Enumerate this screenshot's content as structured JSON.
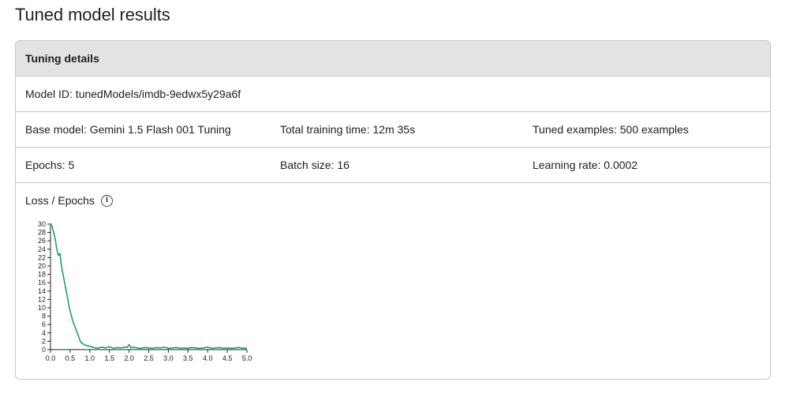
{
  "page": {
    "title": "Tuned model results"
  },
  "details": {
    "header": "Tuning details",
    "model_id": "Model ID: tunedModels/imdb-9edwx5y29a6f",
    "base_model": "Base model: Gemini 1.5 Flash 001 Tuning",
    "training_time": "Total training time: 12m 35s",
    "tuned_examples": "Tuned examples: 500 examples",
    "epochs": "Epochs: 5",
    "batch_size": "Batch size: 16",
    "learning_rate": "Learning rate: 0.0002"
  },
  "chart": {
    "title": "Loss / Epochs",
    "icon": "info-icon"
  },
  "chart_data": {
    "type": "line",
    "title": "Loss / Epochs",
    "xlabel": "",
    "ylabel": "",
    "xlim": [
      0,
      5
    ],
    "ylim": [
      0,
      30
    ],
    "x_ticks": [
      "0.0",
      "0.5",
      "1.0",
      "1.5",
      "2.0",
      "2.5",
      "3.0",
      "3.5",
      "4.0",
      "4.5",
      "5.0"
    ],
    "y_ticks": [
      "0",
      "2",
      "4",
      "6",
      "8",
      "10",
      "12",
      "14",
      "16",
      "18",
      "20",
      "22",
      "24",
      "26",
      "28",
      "30"
    ],
    "color": "#1e9e68",
    "grid": false,
    "series": [
      {
        "x": [
          0.0,
          0.04,
          0.08,
          0.12,
          0.16,
          0.2,
          0.24,
          0.28,
          0.32,
          0.36,
          0.4,
          0.44,
          0.48,
          0.52,
          0.56,
          0.6,
          0.64,
          0.68,
          0.72,
          0.76,
          0.8,
          0.9,
          1.0,
          1.1,
          1.2,
          1.3,
          1.4,
          1.5,
          1.6,
          1.7,
          1.8,
          1.9,
          1.95,
          2.0,
          2.05,
          2.1,
          2.2,
          2.3,
          2.4,
          2.5,
          2.6,
          2.7,
          2.8,
          2.9,
          3.0,
          3.1,
          3.2,
          3.3,
          3.4,
          3.5,
          3.6,
          3.7,
          3.8,
          3.9,
          4.0,
          4.1,
          4.2,
          4.3,
          4.4,
          4.5,
          4.6,
          4.7,
          4.8,
          4.9,
          5.0
        ],
        "y": [
          30,
          29.5,
          28,
          26.5,
          24,
          22.5,
          23,
          20,
          18,
          16,
          14,
          12,
          10,
          8.5,
          7,
          6,
          5,
          4,
          3,
          2,
          1.5,
          1.0,
          0.8,
          0.5,
          0.3,
          0.6,
          0.4,
          0.7,
          0.3,
          0.5,
          0.4,
          0.6,
          0.5,
          1.2,
          0.4,
          0.6,
          0.4,
          0.3,
          0.5,
          0.4,
          0.3,
          0.5,
          0.4,
          0.6,
          0.3,
          0.4,
          0.5,
          0.3,
          0.4,
          0.3,
          0.5,
          0.4,
          0.3,
          0.4,
          0.6,
          0.3,
          0.4,
          0.5,
          0.3,
          0.4,
          0.3,
          0.4,
          0.5,
          0.3,
          0.4
        ]
      }
    ]
  }
}
